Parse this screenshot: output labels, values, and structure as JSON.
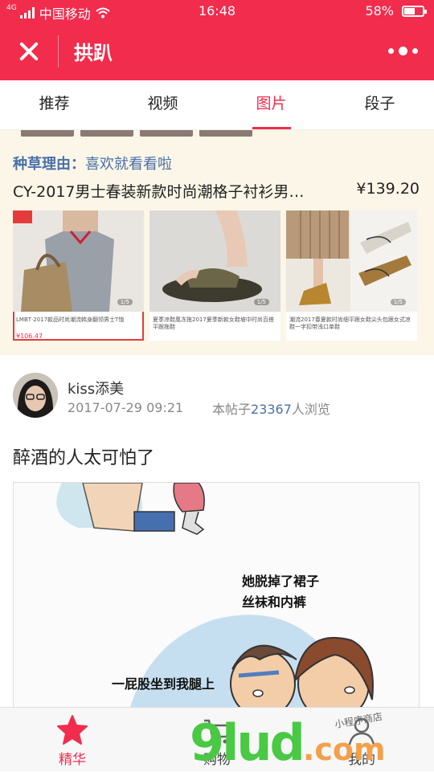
{
  "status_bar": {
    "network": "4G",
    "carrier": "中国移动",
    "time": "16:48",
    "battery": "58%",
    "battery_level": 0.58
  },
  "header": {
    "title": "拱趴"
  },
  "tabs": [
    {
      "label": "推荐",
      "active": false
    },
    {
      "label": "视频",
      "active": false
    },
    {
      "label": "图片",
      "active": true
    },
    {
      "label": "段子",
      "active": false
    }
  ],
  "promo": {
    "reason_label": "种草理由：",
    "reason_text": "喜欢就看看啦",
    "product_name": "CY-2017男士春装新款时尚潮格子衬衫男…",
    "price": "¥139.20",
    "thumbnails": [
      {
        "caption": "LMBT·2017款品时尚潮流韩身翻领男士T恤",
        "price": "¥106.47",
        "pager": "1/5"
      },
      {
        "caption": "夏季凉鞋凰冻拖2017夏季新款女鞋坡中时尚百搭平跟拖鞋",
        "price": "",
        "pager": "1/5"
      },
      {
        "caption": "潮流2017春夏款时尚细平跟女鞋尖头包跟女式凉鞋一字扣带浅口单鞋",
        "price": "",
        "pager": "1/5"
      }
    ]
  },
  "post": {
    "author": "kiss添美",
    "time": "2017-07-29 09:21",
    "views_prefix": "本帖子",
    "views_count": "23367",
    "views_suffix": "人浏览",
    "title": "醉酒的人太可怕了",
    "comic_text_1": "她脱掉了裙子",
    "comic_text_2": "丝袜和内裤",
    "comic_text_3": "一屁股坐到我腿上"
  },
  "bottom_nav": [
    {
      "label": "精华",
      "icon": "star-icon",
      "active": true
    },
    {
      "label": "购物",
      "icon": "cart-icon",
      "active": false
    },
    {
      "label": "我的",
      "icon": "user-icon",
      "active": false
    }
  ],
  "watermark": {
    "main": "9lud",
    "suffix": ".com",
    "shop": "小程序商店"
  },
  "colors": {
    "brand": "#f22c4c",
    "link": "#4a70a8",
    "promo_bg": "#fbf6e7"
  }
}
